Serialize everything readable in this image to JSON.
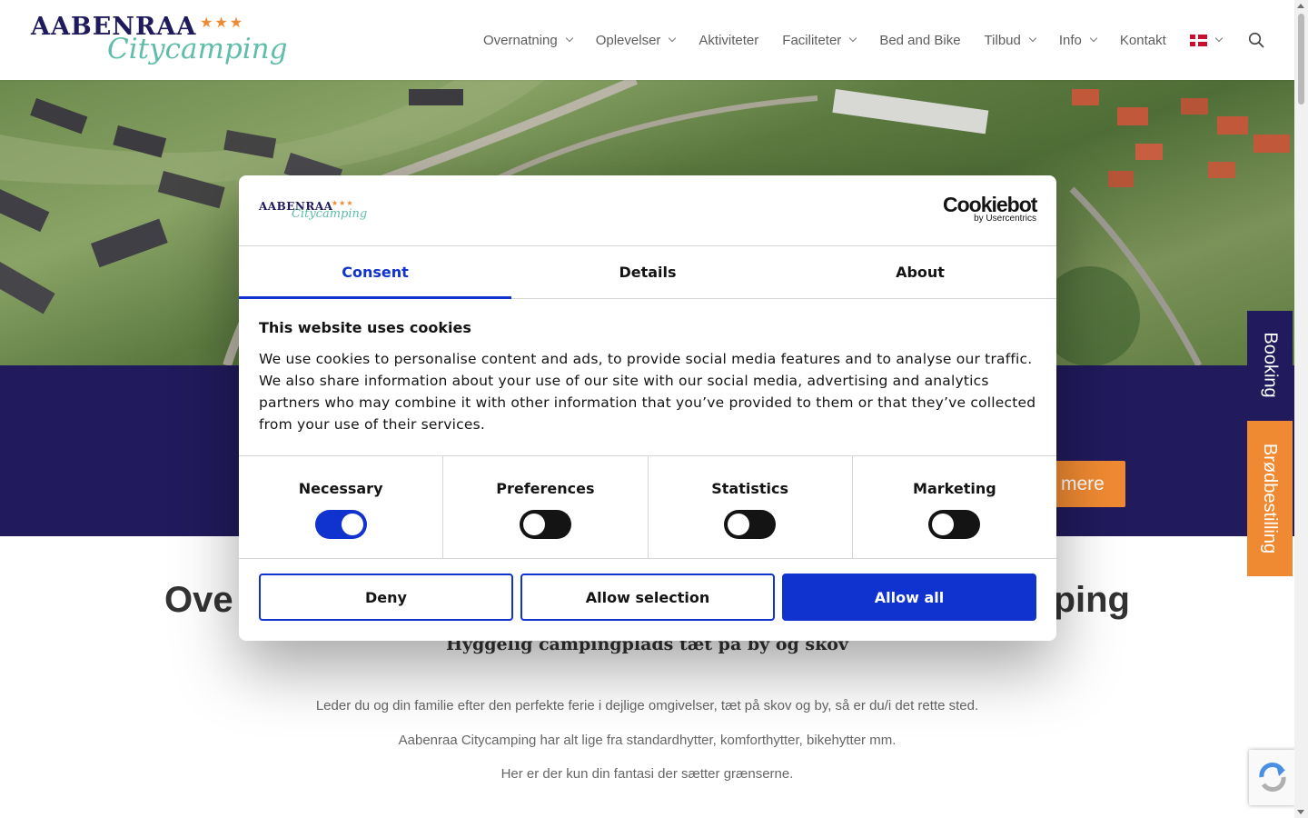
{
  "header": {
    "logo_top": "AABENRAA",
    "logo_stars": "★★★",
    "logo_script": "Citycamping",
    "nav": [
      {
        "label": "Overnatning",
        "has_dropdown": true
      },
      {
        "label": "Oplevelser",
        "has_dropdown": true
      },
      {
        "label": "Aktiviteter",
        "has_dropdown": false
      },
      {
        "label": "Faciliteter",
        "has_dropdown": true
      },
      {
        "label": "Bed and Bike",
        "has_dropdown": false
      },
      {
        "label": "Tilbud",
        "has_dropdown": true
      },
      {
        "label": "Info",
        "has_dropdown": true
      },
      {
        "label": "Kontakt",
        "has_dropdown": false
      }
    ],
    "language_flag": "danish-flag-icon"
  },
  "band": {
    "read_more_label": "mere"
  },
  "side_tabs": {
    "booking": "Booking",
    "bread": "Brødbestilling"
  },
  "main": {
    "title_left": "Ove",
    "title_right": "ping",
    "subtitle": "Hyggelig campingplads tæt på by og skov",
    "paragraphs": [
      "Leder du og din familie efter den perfekte ferie i dejlige omgivelser, tæt på skov og by, så er du/i det rette sted.",
      "Aabenraa Citycamping har alt lige fra standardhytter, komforthytter, bikehytter mm.",
      "Her er der kun din fantasi der sætter grænserne."
    ]
  },
  "cookie_dialog": {
    "brand_main": "Cookiebot",
    "brand_sub": "by Usercentrics",
    "tabs": [
      "Consent",
      "Details",
      "About"
    ],
    "active_tab": "Consent",
    "heading": "This website uses cookies",
    "body": "We use cookies to personalise content and ads, to provide social media features and to analyse our traffic. We also share information about your use of our site with our social media, advertising and analytics partners who may combine it with other information that you’ve provided to them or that they’ve collected from your use of their services.",
    "preferences": [
      {
        "label": "Necessary",
        "enabled": true
      },
      {
        "label": "Preferences",
        "enabled": false
      },
      {
        "label": "Statistics",
        "enabled": false
      },
      {
        "label": "Marketing",
        "enabled": false
      }
    ],
    "buttons": {
      "deny": "Deny",
      "allow_selection": "Allow selection",
      "allow_all": "Allow all"
    }
  },
  "colors": {
    "brand_navy": "#211a5c",
    "brand_orange": "#f08a32",
    "brand_teal": "#5fbda9",
    "cookiebot_blue": "#1032cf"
  }
}
